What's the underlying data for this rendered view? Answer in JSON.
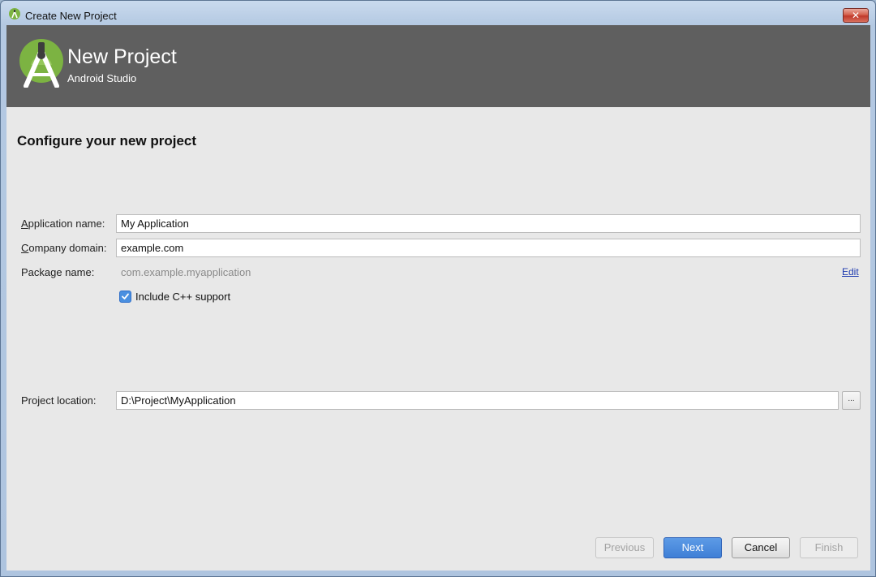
{
  "window": {
    "title": "Create New Project",
    "close_glyph": "✕"
  },
  "banner": {
    "title": "New Project",
    "subtitle": "Android Studio",
    "logo_icon": "android-studio-logo-icon",
    "background": "#5f5f5f"
  },
  "form": {
    "heading": "Configure your new project",
    "app_name": {
      "label_accel": "A",
      "label_rest": "pplication name:",
      "value": "My Application"
    },
    "company_domain": {
      "label_accel": "C",
      "label_rest": "ompany domain:",
      "value": "example.com"
    },
    "package_name": {
      "label": "Package name:",
      "value": "com.example.myapplication",
      "edit_label": "Edit"
    },
    "cpp_support": {
      "label": "Include C++ support",
      "checked": true
    },
    "project_location": {
      "label": "Project location:",
      "value": "D:\\Project\\MyApplication",
      "browse_label": "..."
    }
  },
  "buttons": {
    "previous": "Previous",
    "next": "Next",
    "cancel": "Cancel",
    "finish": "Finish"
  },
  "colors": {
    "accent": "#3f7fd6",
    "link": "#1f3bb0",
    "muted_text": "#8a8a8a"
  }
}
